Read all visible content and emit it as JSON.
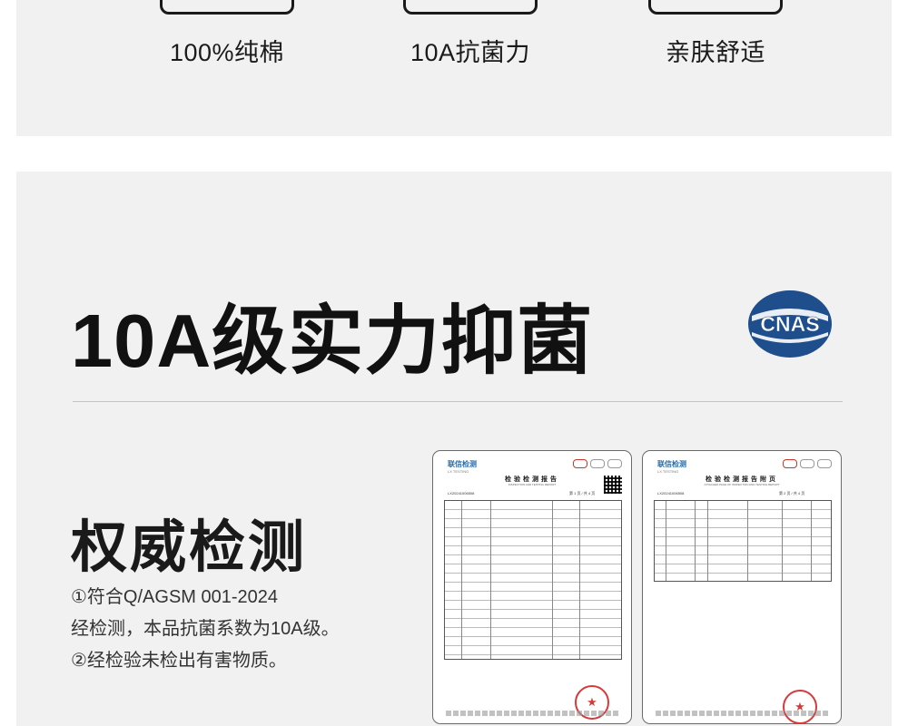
{
  "features": [
    {
      "label": "100%纯棉"
    },
    {
      "label": "10A抗菌力"
    },
    {
      "label": "亲肤舒适"
    }
  ],
  "headline": "10A级实力抑菌",
  "cnas_logo": "CNAS",
  "section": {
    "title": "权威检测",
    "lines": [
      "①符合Q/AGSM 001-2024",
      "经检测，本品抗菌系数为10A级。",
      "②经检验未检出有害物质。"
    ]
  },
  "reports": [
    {
      "brand": "联信检测",
      "brand_en": "LX TESTING",
      "title": "检验检测报告",
      "subtitle": "INSPECTION AND TESTING REPORT",
      "report_no": "LX20241006508",
      "page": "第 1 页 / 共 4 页"
    },
    {
      "brand": "联信检测",
      "brand_en": "LX TESTING",
      "title": "检验检测报告附页",
      "subtitle": "ATTACHED PAGE OF INSPECTION AND TESTING REPORT",
      "report_no": "LX20241006508",
      "page": "第 2 页 / 共 4 页"
    }
  ],
  "colors": {
    "panel": "#f1f1f1",
    "text": "#1a1a1a",
    "cnas_blue": "#1e4e8c",
    "stamp_red": "#d63a3a"
  }
}
